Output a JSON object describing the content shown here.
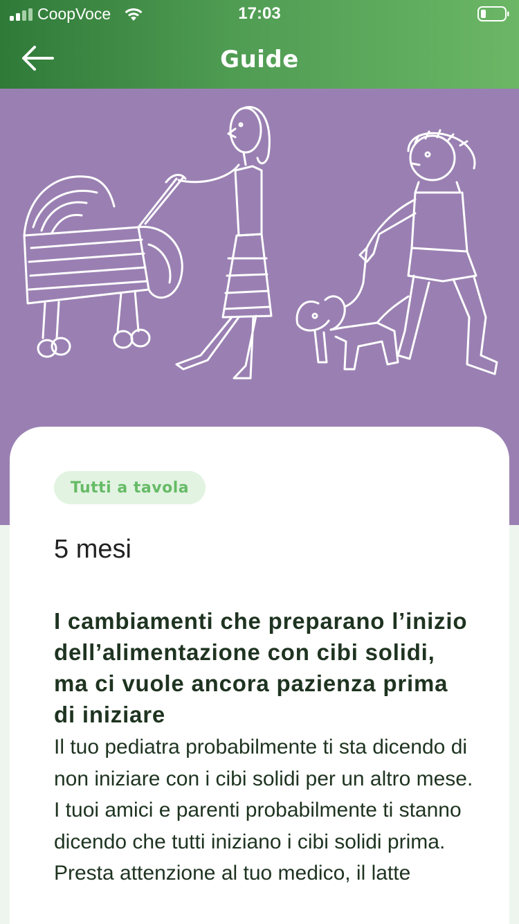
{
  "status_bar": {
    "carrier": "CoopVoce",
    "time": "17:03",
    "icons": [
      "signal-icon",
      "wifi-icon",
      "battery-icon"
    ]
  },
  "nav": {
    "title": "Guide",
    "back_icon": "arrow-left-icon"
  },
  "hero": {
    "illustration": "child-drawing-family-pram-dog",
    "background": "#9a80b2"
  },
  "article": {
    "tag": "Tutti a tavola",
    "age": "5 mesi",
    "title": "I cambiamenti che preparano l’inizio dell’alimentazione con cibi solidi, ma ci vuole ancora pazienza prima di iniziare",
    "body": "Il tuo pediatra probabilmente ti sta dicendo di non iniziare con i cibi solidi per un altro mese. I tuoi amici e parenti probabilmente ti stanno dicendo che tutti iniziano i cibi solidi prima. Presta attenzione al tuo medico, il latte"
  },
  "colors": {
    "header_start": "#2f7a38",
    "header_end": "#6bb766",
    "tag_bg": "#e2f3e2",
    "tag_text": "#66bb66",
    "text": "#1e3320"
  }
}
